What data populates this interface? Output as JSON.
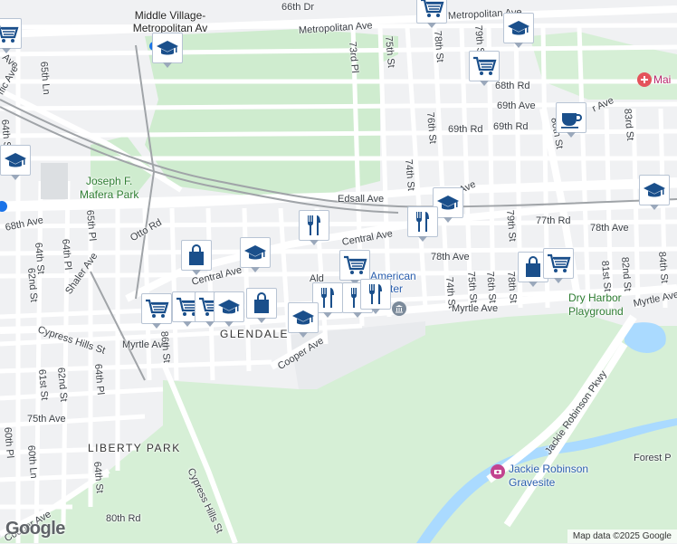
{
  "map": {
    "colors": {
      "background": "#f0f1f3",
      "park": "#cfeccf",
      "cemetery": "#d6efd6",
      "water": "#aadaff",
      "road": "#ffffff",
      "rail": "#a0a4a8",
      "pin_icon": "#1a4f8b"
    },
    "street_labels": {
      "s66th_dr": "66th Dr",
      "middle_village": "Middle Village-Metropolitan Av",
      "metropolitan_ave_top": "Metropolitan Ave",
      "metropolitan_ave_left": "Metropolitan Ave",
      "s73rd_pl": "73rd Pl",
      "s75th_st_top": "75th St",
      "s78th_st_top": "78th St",
      "s79th_st_top": "79th St",
      "s68th_rd": "68th Rd",
      "s69th_ave": "69th Ave",
      "s69th_rd": "69th Rd",
      "s76th_st_mid": "76th St",
      "s80th_st": "80th St",
      "s83rd_st": "83rd St",
      "s65th_ln": "65th Ln",
      "s64th_st_left": "64th St",
      "s74th_st_mid": "74th St",
      "edsall_ave": "Edsall Ave",
      "s68th_ave": "68th Ave",
      "s65th_pl": "65th Pl",
      "otto_rd": "Otto Rd",
      "central_ave_mid": "Central Ave",
      "central_ave_left": "Central Ave",
      "s79th_st_mid": "79th St",
      "s77th_rd": "77th Rd",
      "s78th_ave_right": "78th Ave",
      "s78th_ave_mid": "78th Ave",
      "s64th_pl": "64th Pl",
      "s64th_st_mid": "64th St",
      "s62nd_st_left": "62nd St",
      "shaler_ave": "Shaler Ave",
      "s74th_st_low": "74th St",
      "s75th_st_low": "75th St",
      "s76th_st_low": "76th St",
      "s78th_st_low": "78th St",
      "s81st_st": "81st St",
      "s82nd_st": "82nd St",
      "s84th_st": "84th St",
      "myrtle_ave_right": "Myrtle Ave",
      "myrtle_ave_mid": "Myrtle Ave",
      "myrtle_ave_left": "Myrtle Ave",
      "cypress_hills_st_top": "Cypress Hills St",
      "glendale": "GLENDALE",
      "cooper_ave_mid": "Cooper Ave",
      "s86th_st": "86th St",
      "s61st_st": "61st St",
      "s62nd_st_low": "62nd St",
      "s64th_pl_low": "64th Pl",
      "s75th_ave": "75th Ave",
      "s60th_pl": "60th Pl",
      "s60th_ln": "60th Ln",
      "liberty_park": "LIBERTY PARK",
      "s64th_st_low": "64th St",
      "s80th_rd": "80th Rd",
      "cooper_ave_low": "Cooper Ave",
      "cypress_hills_st_low": "Cypress Hills St",
      "jackie_robinson_pkwy": "Jackie Robinson Pkwy",
      "forest_pk": "Forest P",
      "affic_ave": "ffic Ave",
      "mai": "Mai",
      "r_ave": "r Ave",
      "ave_top": "Ave",
      "ave_edsall_right": "Ave"
    },
    "place_labels": {
      "joseph_f_mafera_park": "Joseph F.\nMafera Park",
      "dry_harbor_playground": "Dry Harbor\nPlayground",
      "american_center": "American\nCenter",
      "jackie_robinson_gravesite": "Jackie Robinson\nGravesite",
      "ald": "Ald"
    },
    "pins": [
      {
        "icon": "school-icon"
      },
      {
        "icon": "school-icon"
      },
      {
        "icon": "school-icon"
      },
      {
        "icon": "shopping-cart-icon"
      },
      {
        "icon": "shopping-cart-icon"
      },
      {
        "icon": "coffee-icon"
      },
      {
        "icon": "school-icon"
      },
      {
        "icon": "school-icon"
      },
      {
        "icon": "restaurant-icon"
      },
      {
        "icon": "restaurant-icon"
      },
      {
        "icon": "shopping-bag-icon"
      },
      {
        "icon": "school-icon"
      },
      {
        "icon": "shopping-cart-icon"
      },
      {
        "icon": "shopping-bag-icon"
      },
      {
        "icon": "shopping-cart-icon"
      },
      {
        "icon": "shopping-cart-icon"
      },
      {
        "icon": "shopping-cart-icon"
      },
      {
        "icon": "shopping-cart-icon"
      },
      {
        "icon": "school-icon"
      },
      {
        "icon": "shopping-bag-icon"
      },
      {
        "icon": "restaurant-icon"
      },
      {
        "icon": "restaurant-icon"
      },
      {
        "icon": "restaurant-icon"
      },
      {
        "icon": "school-icon"
      },
      {
        "icon": "shopping-cart-icon"
      }
    ],
    "logo": "Google",
    "attribution": "Map data ©2025 Google"
  }
}
